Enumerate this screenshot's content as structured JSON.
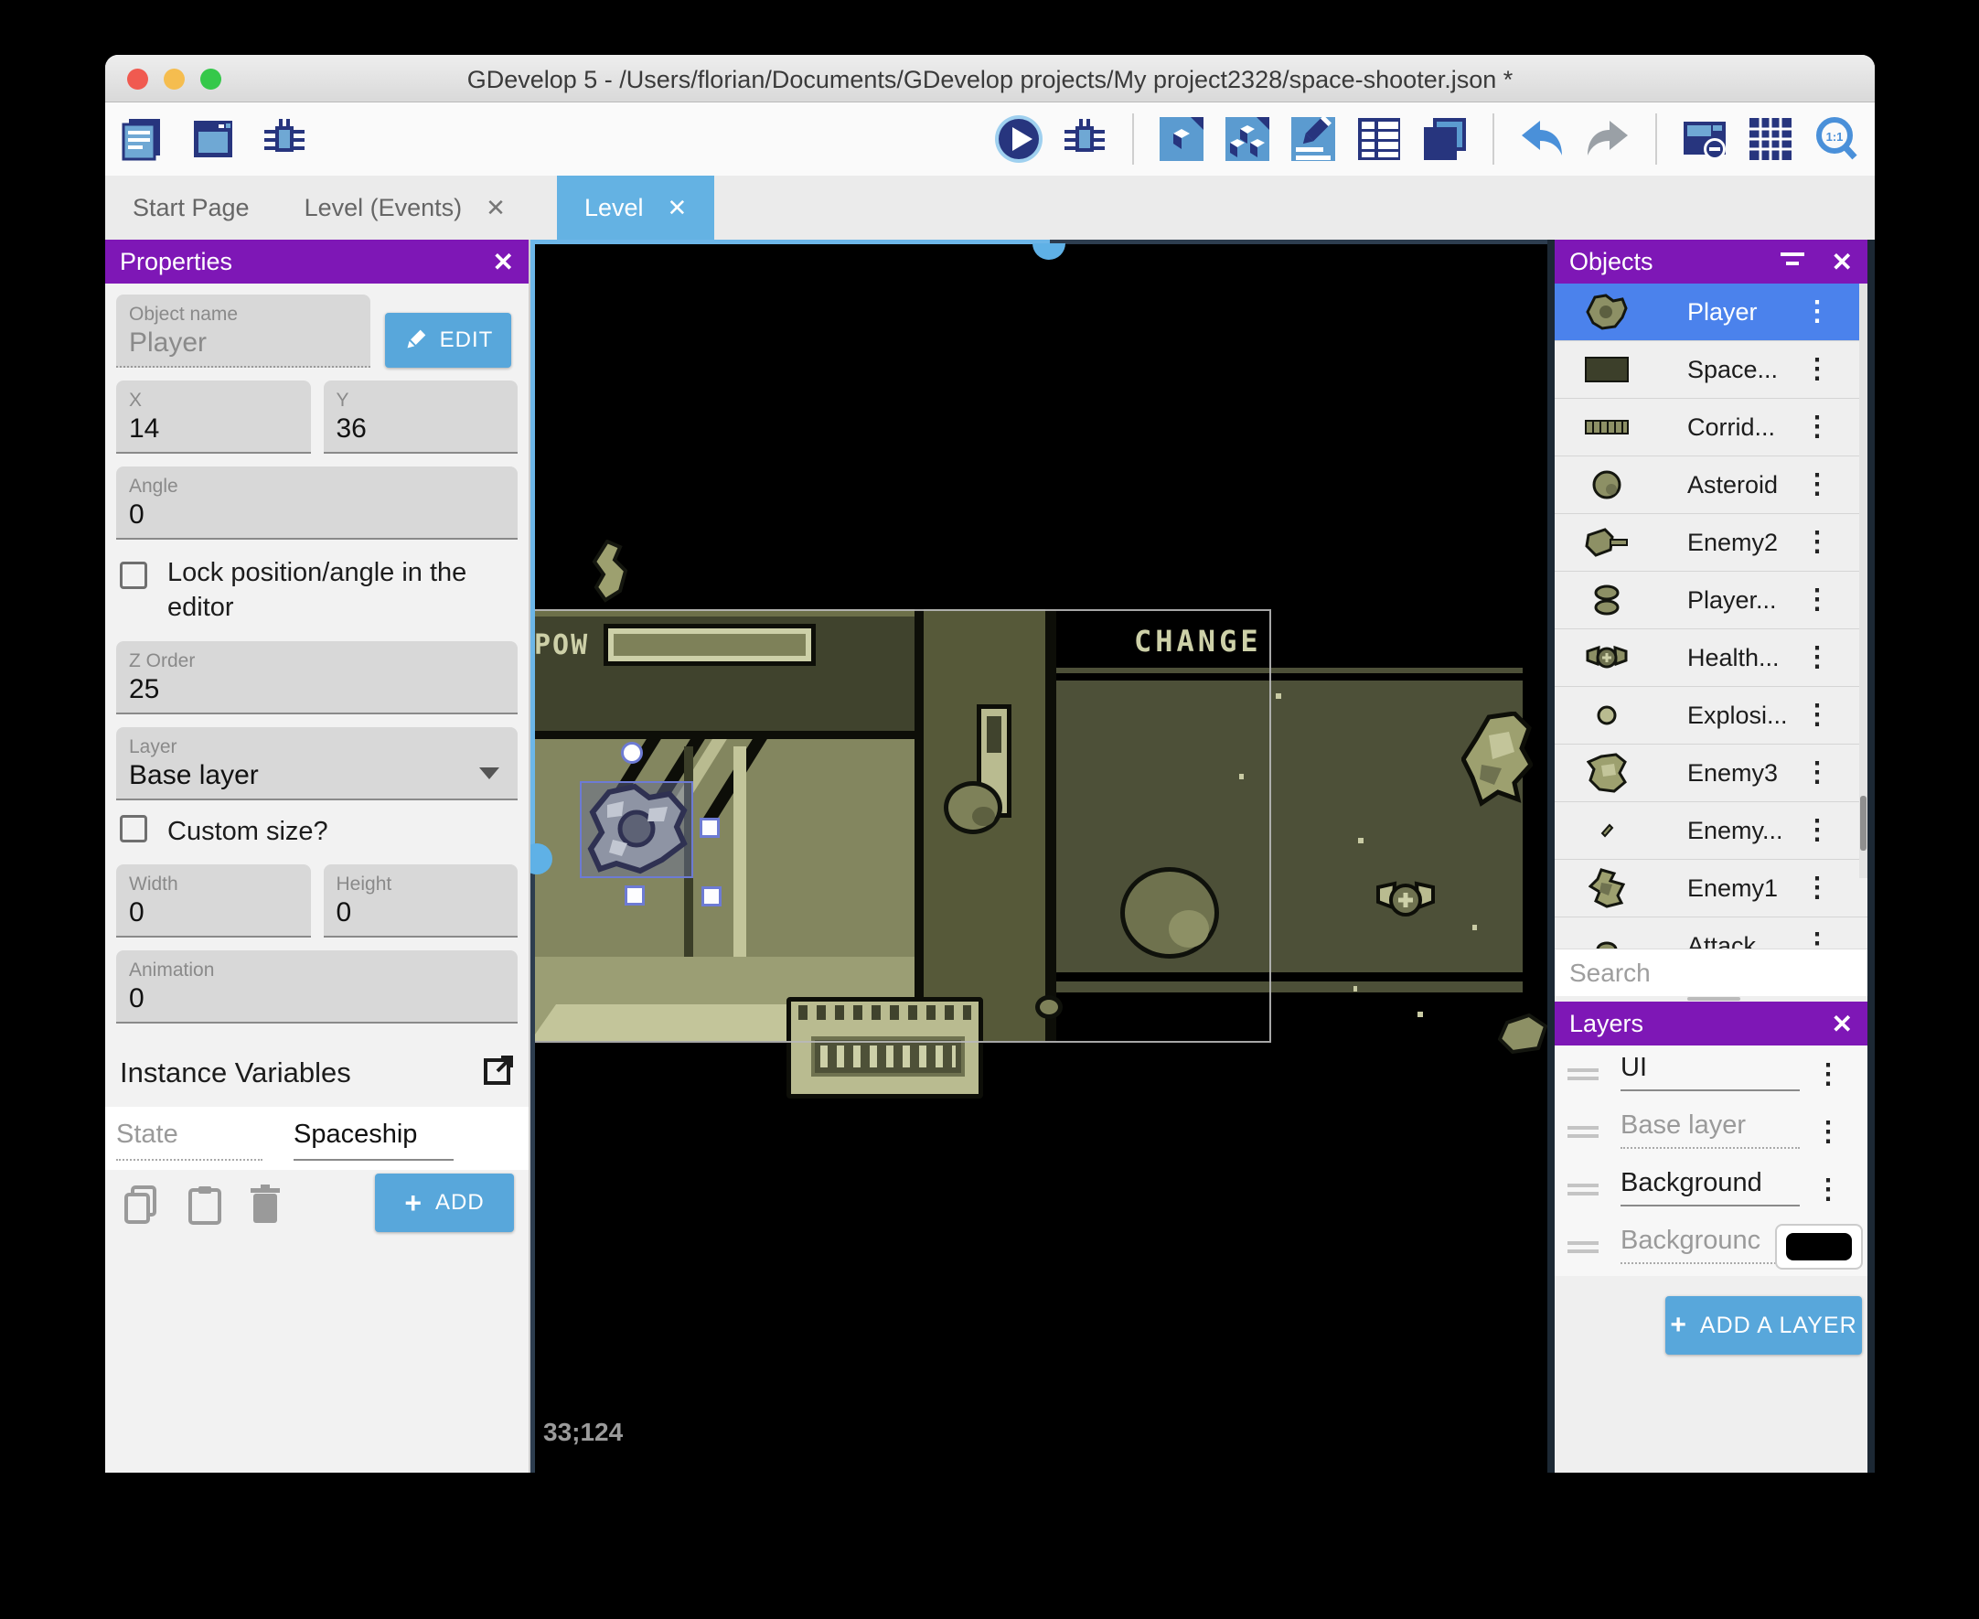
{
  "window": {
    "title": "GDevelop 5 - /Users/florian/Documents/GDevelop projects/My project2328/space-shooter.json *"
  },
  "tabs": {
    "start_page": "Start Page",
    "level_events": "Level (Events)",
    "level": "Level"
  },
  "toolbar": {
    "icons": [
      "project-manager-icon",
      "scene-window-icon",
      "debugger-icon",
      "play-icon",
      "debug-icon",
      "objects-page-icon",
      "instances-page-icon",
      "edit-scene-icon",
      "events-list-icon",
      "copy-scenes-icon",
      "undo-icon",
      "redo-icon",
      "window-mask-icon",
      "grid-icon",
      "zoom-one-to-one-icon"
    ]
  },
  "properties": {
    "title": "Properties",
    "object_name_label": "Object name",
    "object_name_value": "Player",
    "edit_label": "EDIT",
    "x_label": "X",
    "x_value": "14",
    "y_label": "Y",
    "y_value": "36",
    "angle_label": "Angle",
    "angle_value": "0",
    "lock_label": "Lock position/angle in the editor",
    "zorder_label": "Z Order",
    "zorder_value": "25",
    "layer_label": "Layer",
    "layer_value": "Base layer",
    "custom_size_label": "Custom size?",
    "width_label": "Width",
    "width_value": "0",
    "height_label": "Height",
    "height_value": "0",
    "animation_label": "Animation",
    "animation_value": "0",
    "instance_variables_label": "Instance Variables",
    "variable_name": "State",
    "variable_value": "Spaceship",
    "add_label": "ADD"
  },
  "canvas": {
    "pow_label": "POW",
    "change_label": "CHANGE",
    "coordinates": "33;124"
  },
  "objects": {
    "title": "Objects",
    "search_placeholder": "Search",
    "items": [
      {
        "label": "Player",
        "selected": true
      },
      {
        "label": "Space..."
      },
      {
        "label": "Corrid..."
      },
      {
        "label": "Asteroid"
      },
      {
        "label": "Enemy2"
      },
      {
        "label": "Player..."
      },
      {
        "label": "Health..."
      },
      {
        "label": "Explosi..."
      },
      {
        "label": "Enemy3"
      },
      {
        "label": "Enemy..."
      },
      {
        "label": "Enemy1"
      },
      {
        "label": "Attack..."
      }
    ]
  },
  "layers": {
    "title": "Layers",
    "items": [
      {
        "label": "UI"
      },
      {
        "label": "Base layer",
        "dim": true
      },
      {
        "label": "Background"
      },
      {
        "label": "Backgrounc",
        "dim": true,
        "swatch": "#000000"
      }
    ],
    "add_label": "ADD A LAYER"
  },
  "colors": {
    "header_purple": "#7e17b6",
    "button_blue": "#58a7db",
    "active_tab_blue": "#64b2e3",
    "selected_row_blue": "#4b82ec",
    "selection_outline": "#6d7bd4",
    "window_edge_blue": "#6cb6e8",
    "game_olive_dark": "#4d5038",
    "game_olive_light": "#83865f",
    "game_pale": "#cdd0a8"
  }
}
